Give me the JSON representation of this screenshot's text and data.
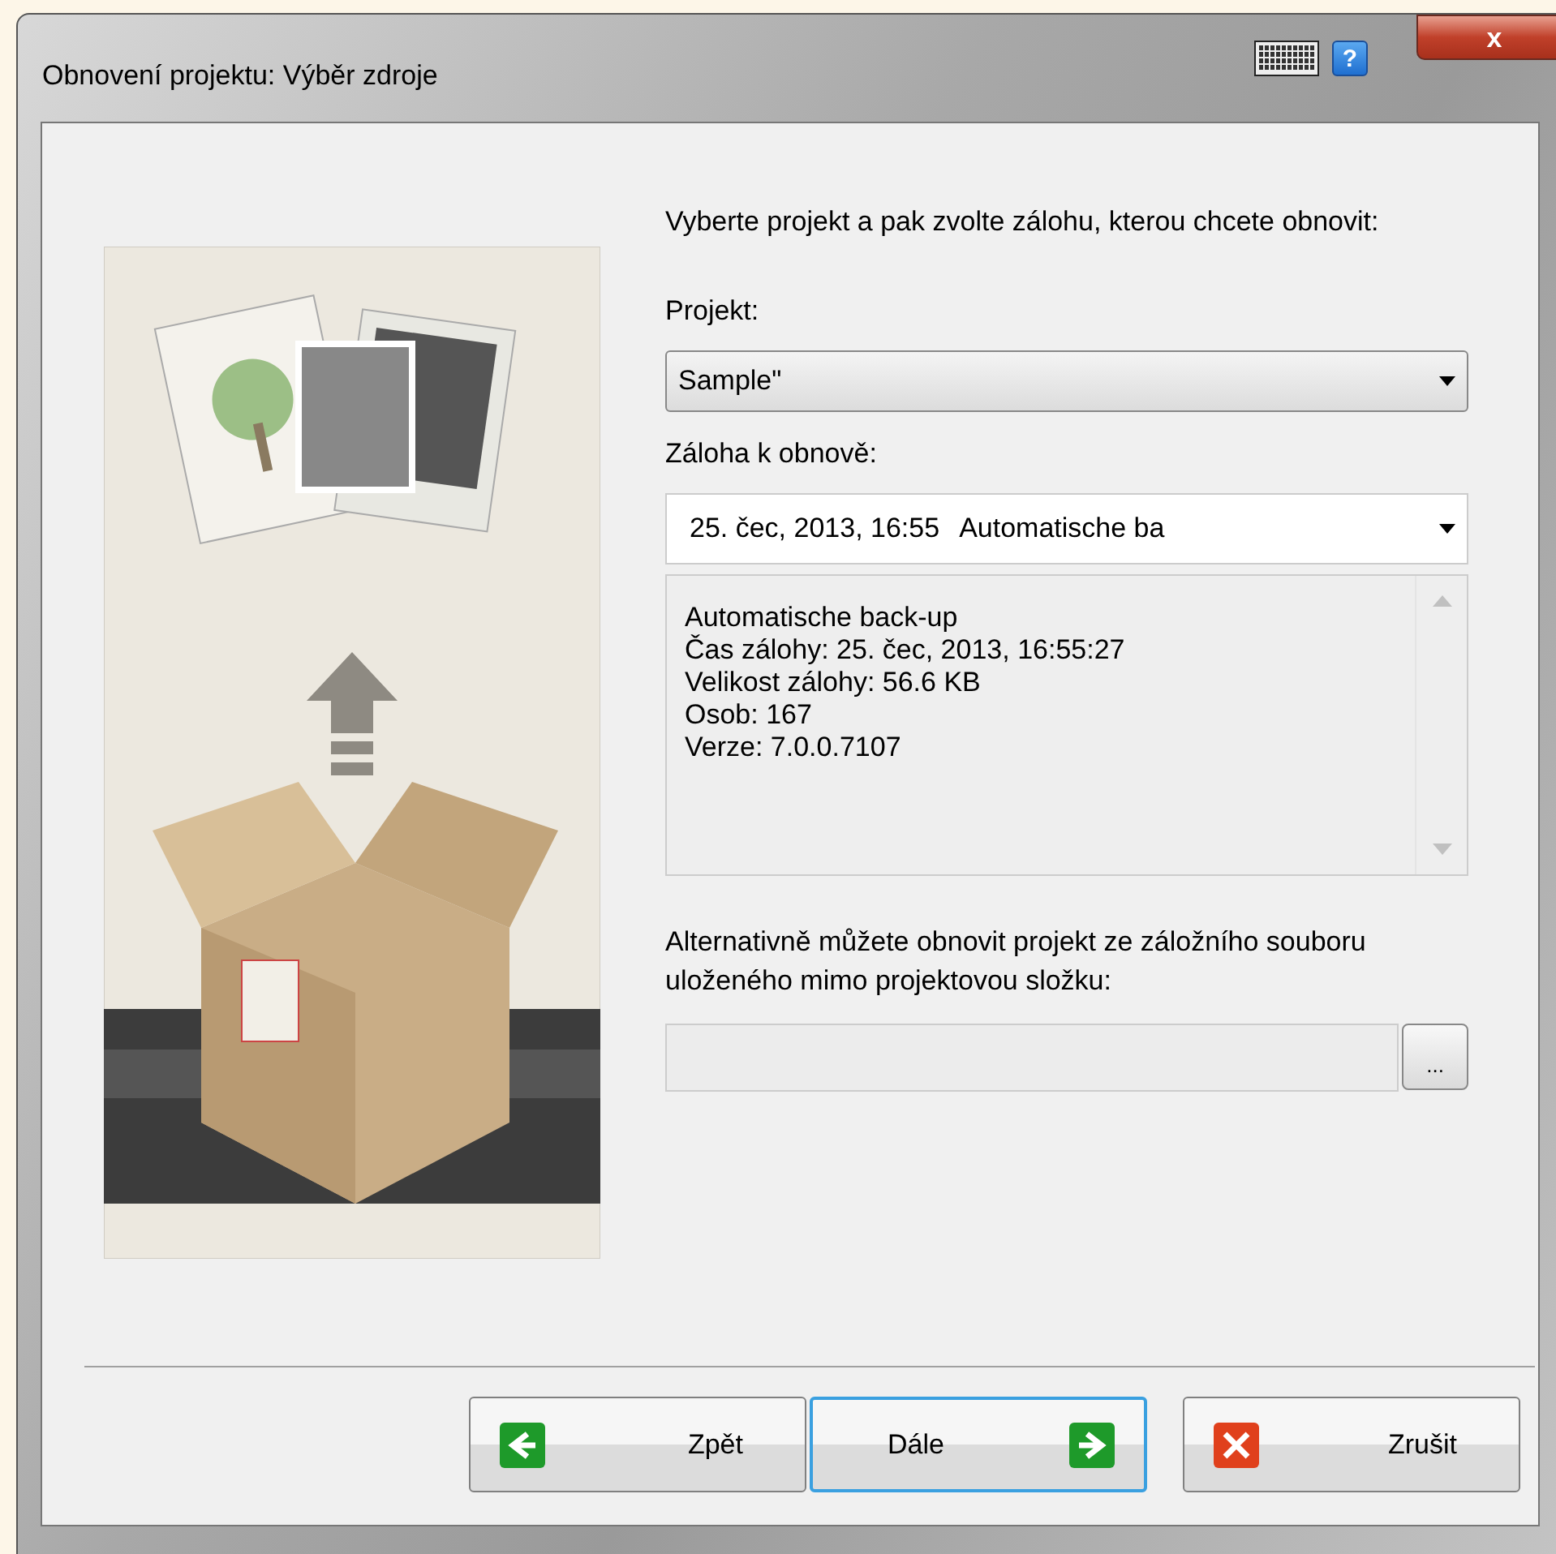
{
  "window": {
    "title": "Obnovení projektu: Výběr zdroje",
    "title_buttons": [
      {
        "kind": "keyboard"
      },
      {
        "kind": "help",
        "label": "?"
      },
      {
        "kind": "close",
        "label": "x"
      }
    ]
  },
  "intro": "Vyberte projekt a pak zvolte zálohu, kterou chcete obnovit:",
  "project": {
    "label": "Projekt:",
    "value": "Sample\""
  },
  "backup": {
    "label": "Záloha k obnově:",
    "date": "25. čec, 2013, 16:55",
    "name": "Automatische ba"
  },
  "details": [
    "Automatische back-up",
    "Čas zálohy: 25. čec, 2013, 16:55:27",
    "Velikost zálohy: 56.6 KB",
    "Osob: 167",
    "Verze: 7.0.0.7107"
  ],
  "alternative": {
    "text": "Alternativně můžete obnovit projekt ze záložního souboru uloženého mimo projektovou složku:",
    "browse": "..."
  },
  "buttons": [
    {
      "label": "Zpět",
      "kind": "back",
      "focused": false
    },
    {
      "label": "Dále",
      "kind": "next",
      "focused": true
    },
    {
      "label": "Zrušit",
      "kind": "cancel",
      "focused": false
    }
  ]
}
